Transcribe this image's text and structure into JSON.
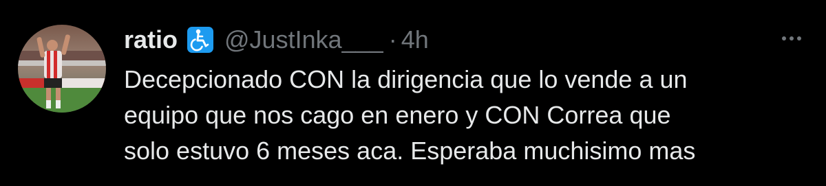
{
  "tweet": {
    "display_name": "ratio",
    "badge_icon": "accessibility-wheelchair-icon",
    "badge_color": "#1d9bf0",
    "handle": "@JustInka___",
    "separator": "·",
    "time": "4h",
    "more_icon": "more-horizontal-icon",
    "text_lines": [
      "Decepcionado CON la dirigencia que lo vende a un",
      "equipo que nos cago en enero y CON Correa que",
      "solo estuvo 6 meses aca. Esperaba muchisimo mas"
    ]
  },
  "colors": {
    "background": "#000000",
    "primary_text": "#e7e9ea",
    "secondary_text": "#71767b"
  }
}
